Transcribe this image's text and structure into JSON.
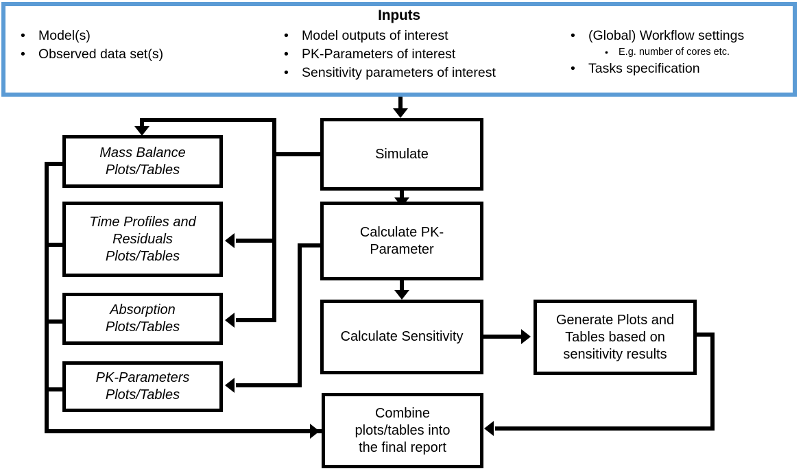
{
  "diagram": {
    "inputs_panel": {
      "title": "Inputs",
      "border_color": "#5B9BD5",
      "columns": [
        {
          "items": [
            {
              "text": "Model(s)",
              "sub": []
            },
            {
              "text": "Observed data set(s)",
              "sub": []
            }
          ]
        },
        {
          "items": [
            {
              "text": "Model outputs of interest",
              "sub": []
            },
            {
              "text": "PK-Parameters of interest",
              "sub": []
            },
            {
              "text": "Sensitivity parameters of interest",
              "sub": []
            }
          ]
        },
        {
          "items": [
            {
              "text": "(Global) Workflow settings",
              "sub": [
                "E.g. number of cores etc."
              ]
            },
            {
              "text": "Tasks specification",
              "sub": []
            }
          ]
        }
      ]
    },
    "nodes": {
      "mass_balance": "Mass Balance\nPlots/Tables",
      "time_profiles": "Time Profiles and\nResiduals\nPlots/Tables",
      "absorption": "Absorption\nPlots/Tables",
      "pk_parameters": "PK-Parameters\nPlots/Tables",
      "simulate": "Simulate",
      "calculate_pk": "Calculate PK-\nParameter",
      "calculate_sensitivity": "Calculate Sensitivity",
      "generate_sensitivity_outputs": "Generate Plots and\nTables based on\nsensitivity results",
      "combine_report": "Combine\nplots/tables into\nthe final report"
    },
    "colors": {
      "node_border": "#000000",
      "connector": "#000000",
      "panel_border": "#5B9BD5",
      "background": "#ffffff"
    }
  }
}
